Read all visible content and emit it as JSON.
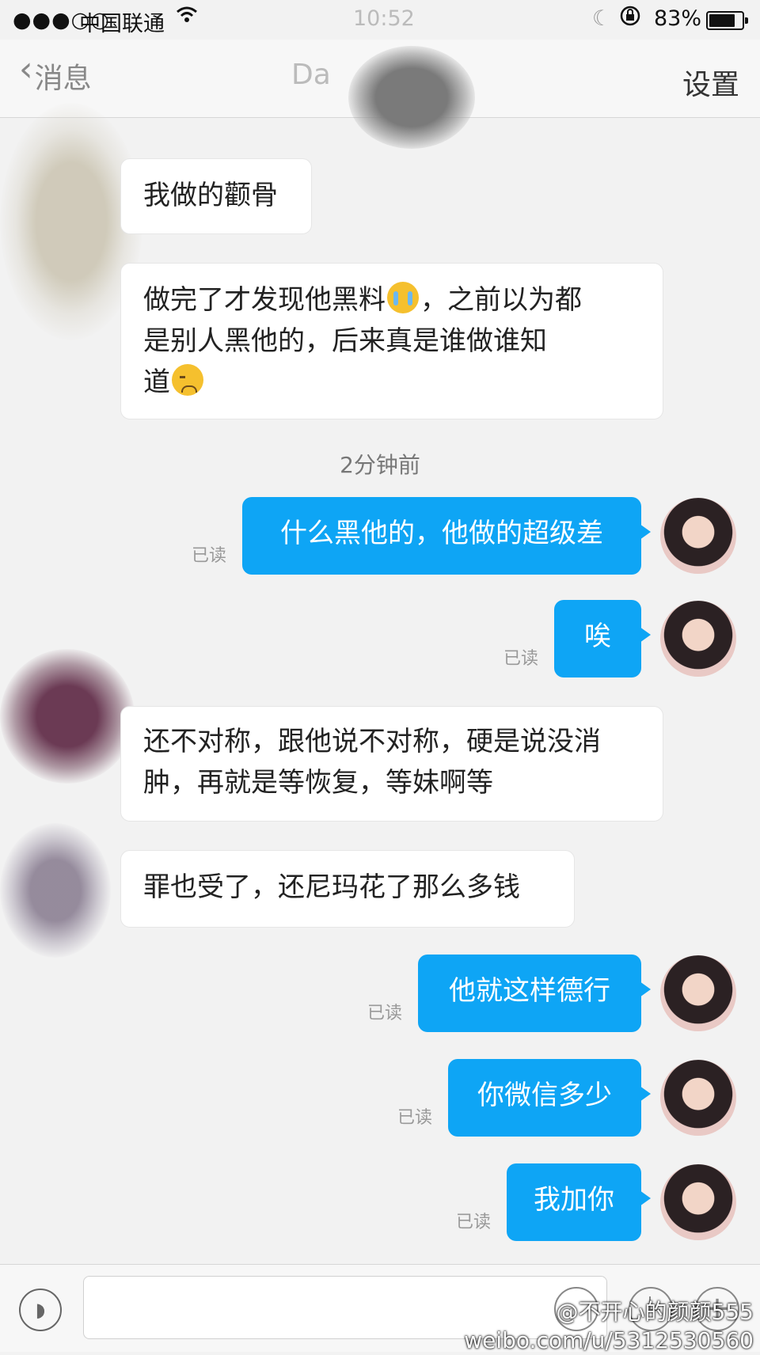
{
  "status_bar": {
    "signal": "●●●○○",
    "carrier": "中国联通",
    "time": "10:52",
    "battery": "83%",
    "battery_level": 0.83
  },
  "nav": {
    "back_label": "消息",
    "title": "Da",
    "settings_label": "设置"
  },
  "timestamp": "2分钟前",
  "messages": [
    {
      "side": "in",
      "text": "我做的颧骨"
    },
    {
      "side": "in",
      "line1_a": "做完了才发现他黑料",
      "line1_b": "，之前以为都",
      "line2": "是别人黑他的，后来真是谁做谁知",
      "line3": "道"
    },
    {
      "side": "out",
      "text": "什么黑他的，他做的超级差",
      "status": "已读"
    },
    {
      "side": "out",
      "text": "唉",
      "status": "已读"
    },
    {
      "side": "in",
      "line1": "还不对称，跟他说不对称，硬是说没消",
      "line2": "肿，再就是等恢复，等妹啊等"
    },
    {
      "side": "in",
      "text": "罪也受了，还尼玛花了那么多钱"
    },
    {
      "side": "out",
      "text": "他就这样德行",
      "status": "已读"
    },
    {
      "side": "out",
      "text": "你微信多少",
      "status": "已读"
    },
    {
      "side": "out",
      "text": "我加你",
      "status": "已读"
    }
  ],
  "watermark": {
    "handle": "@不开心的颜颜555",
    "url": "weibo.com/u/5312530560"
  }
}
